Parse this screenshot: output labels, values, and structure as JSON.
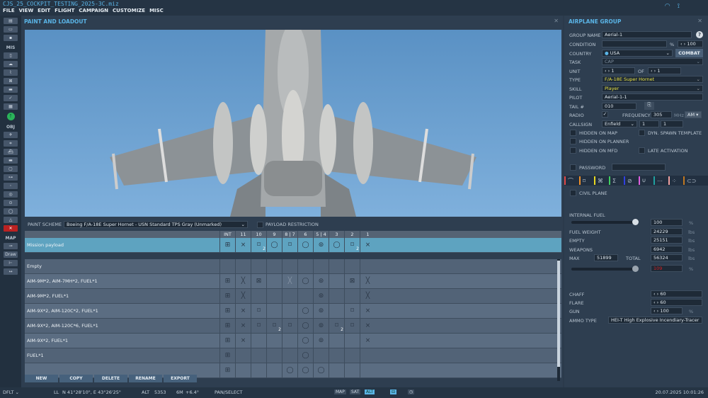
{
  "window": {
    "title": "CJS_25_COCKPIT_TESTING_2025-3C.miz"
  },
  "menu": [
    "FILE",
    "VIEW",
    "EDIT",
    "FLIGHT",
    "CAMPAIGN",
    "CUSTOMIZE",
    "MISC"
  ],
  "left_toolbar": {
    "top": [
      "new-file",
      "open-folder",
      "save"
    ],
    "mis_label": "MIS",
    "mis": [
      "briefing",
      "weather",
      "route",
      "trigger-zone",
      "templates",
      "check",
      "goals"
    ],
    "obj_label": "OBJ",
    "obj": [
      "airplane",
      "helicopter",
      "ship",
      "ground-unit",
      "static",
      "airbase",
      "farp",
      "target-zone",
      "navpoint",
      "group",
      "formation",
      "delete"
    ],
    "map_label": "MAP",
    "map": [
      "map-toggle",
      "Draw",
      "ruler",
      "measure"
    ]
  },
  "loadout": {
    "title": "PAINT AND LOADOUT",
    "paint_scheme_label": "PAINT SCHEME",
    "paint_scheme": "Boeing F/A-18E Super Hornet - USN Standard TPS Gray (Unmarked)",
    "payload_restriction": "PAYLOAD RESTRICTION",
    "stations": [
      "INT",
      "11",
      "10",
      "9",
      "8 | 7",
      "6",
      "5 | 4",
      "3",
      "2",
      "1"
    ],
    "mission": {
      "name": "Mission payload",
      "cells": [
        "pod",
        "xs",
        "xb:2",
        "circle",
        "xb",
        "circle",
        "tank",
        "circle",
        "xb:2",
        "xs"
      ]
    },
    "rows": [
      {
        "name": "Empty",
        "cells": [
          "",
          "",
          "",
          "",
          "",
          "",
          "",
          "",
          "",
          ""
        ]
      },
      {
        "name": "AIM-9M*2, AIM-7MH*2, FUEL*1",
        "cells": [
          "pod",
          "xl",
          "xbl",
          "",
          "xt",
          "circle",
          "tank",
          "",
          "xbl",
          "xl"
        ]
      },
      {
        "name": "AIM-9M*2, FUEL*1",
        "cells": [
          "pod",
          "xl",
          "",
          "",
          "",
          "",
          "tank",
          "",
          "",
          "xl"
        ]
      },
      {
        "name": "AIM-9X*2, AIM-120C*2, FUEL*1",
        "cells": [
          "pod",
          "xs",
          "xb",
          "",
          "",
          "circle",
          "tank",
          "",
          "xb",
          "xs"
        ]
      },
      {
        "name": "AIM-9X*2, AIM-120C*6, FUEL*1",
        "cells": [
          "pod",
          "xs",
          "xb",
          "xb:2",
          "xb",
          "circle",
          "tank",
          "xb:2",
          "xb",
          "xs"
        ]
      },
      {
        "name": "AIM-9X*2, FUEL*1",
        "cells": [
          "pod",
          "xs",
          "",
          "",
          "",
          "circle",
          "tank",
          "",
          "",
          "xs"
        ]
      },
      {
        "name": "FUEL*1",
        "cells": [
          "pod",
          "",
          "",
          "",
          "",
          "circle",
          "",
          "",
          "",
          ""
        ]
      },
      {
        "name": "",
        "cells": [
          "pod",
          "",
          "",
          "",
          "circle",
          "circle",
          "circle",
          "",
          "",
          ""
        ]
      }
    ],
    "buttons": [
      "NEW",
      "COPY",
      "DELETE",
      "RENAME",
      "EXPORT"
    ]
  },
  "group": {
    "title": "AIRPLANE GROUP",
    "group_name_label": "GROUP NAME",
    "group_name": "Aerial-1",
    "condition_label": "CONDITION",
    "condition": "",
    "pct": "%",
    "condition_value": "100",
    "country_label": "COUNTRY",
    "country": "USA",
    "combat": "COMBAT",
    "task_label": "TASK",
    "task": "CAP",
    "unit_label": "UNIT",
    "unit": "1",
    "of": "OF",
    "unit_of": "1",
    "type_label": "TYPE",
    "type": "F/A-18E Super Hornet",
    "skill_label": "SKILL",
    "skill": "Player",
    "pilot_label": "PILOT",
    "pilot": "Aerial-1-1",
    "tail_label": "TAIL #",
    "tail": "010",
    "radio_label": "RADIO",
    "frequency_label": "FREQUENCY",
    "frequency": "305",
    "mhz": "MHz",
    "modulation": "AM",
    "callsign_label": "CALLSIGN",
    "callsign": "Enfield",
    "callsign_1": "1",
    "callsign_2": "1",
    "hidden_map": "HIDDEN ON MAP",
    "dyn_spawn": "DYN. SPAWN TEMPLATE",
    "hidden_planner": "HIDDEN ON PLANNER",
    "hidden_mfd": "HIDDEN ON MFD",
    "late_activation": "LATE ACTIVATION",
    "password_label": "PASSWORD",
    "tabs": [
      {
        "icon": "route",
        "color": "#e04848"
      },
      {
        "icon": "payload",
        "color": "#f0902a"
      },
      {
        "icon": "targets",
        "color": "#e8d820"
      },
      {
        "icon": "summary",
        "color": "#40d060"
      },
      {
        "icon": "failures",
        "color": "#3040e0"
      },
      {
        "icon": "radio",
        "color": "#e060e0"
      },
      {
        "icon": "more",
        "color": "#20a0a0"
      },
      {
        "icon": "spread",
        "color": "#f0a0a0"
      },
      {
        "icon": "pods",
        "color": "#c07820"
      }
    ],
    "tab_glyphs": [
      "⌒",
      "⌑",
      "⌘",
      "Σ",
      "⊘",
      "⍦",
      "⋯",
      "⁘",
      "⊂⊃"
    ],
    "civil_plane": "CIVIL PLANE",
    "internal_fuel_label": "INTERNAL FUEL",
    "internal_fuel": "100",
    "internal_fuel_fraction": 1.0,
    "fuel_weight_label": "FUEL WEIGHT",
    "fuel_weight": "24229",
    "empty_label": "EMPTY",
    "empty": "25151",
    "weapons_label": "WEAPONS",
    "weapons": "6942",
    "max_label": "MAX",
    "max": "51899",
    "total_label": "TOTAL",
    "total": "56324",
    "total_pct": "109",
    "total_fraction": 1.0,
    "lbs": "lbs",
    "chaff_label": "CHAFF",
    "chaff": "60",
    "flare_label": "FLARE",
    "flare": "60",
    "gun_label": "GUN",
    "gun": "100",
    "ammo_label": "AMMO TYPE",
    "ammo": "HEI-T High Explosive Incendiary-Tracer"
  },
  "status": {
    "mode": "DFLT",
    "ll_label": "LL",
    "coords": "N 41°28'10\", E 43°26'25\"",
    "alt_label": "ALT",
    "alt": "5353",
    "magvar_label": "6M",
    "magvar": "+6.4°",
    "tool": "PAN/SELECT",
    "map": "MAP",
    "sat": "SAT",
    "alt_btn": "ALT",
    "datetime": "20.07.2025 10:01:26"
  }
}
